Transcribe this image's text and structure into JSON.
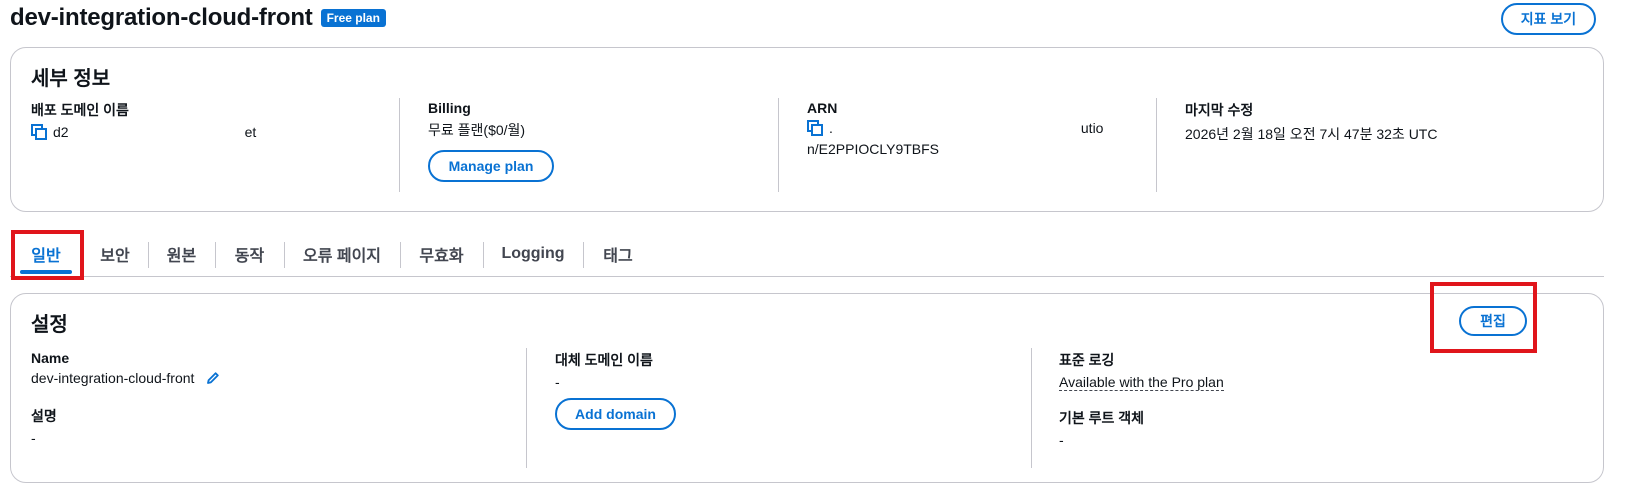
{
  "header": {
    "title": "dev-integration-cloud-front",
    "badge": "Free plan",
    "metrics_button": "지표 보기"
  },
  "details": {
    "heading": "세부 정보",
    "domain": {
      "label": "배포 도메인 이름",
      "value_start": "d2",
      "value_end": "et"
    },
    "billing": {
      "label": "Billing",
      "value": "무료 플랜($0/월)",
      "button": "Manage plan"
    },
    "arn": {
      "label": "ARN",
      "value_start": ".",
      "value_end": "utio",
      "value_line2": "n/E2PPIOCLY9TBFS"
    },
    "modified": {
      "label": "마지막 수정",
      "value": "2026년 2월 18일 오전 7시 47분 32초 UTC"
    }
  },
  "tabs": [
    {
      "label": "일반",
      "active": true
    },
    {
      "label": "보안"
    },
    {
      "label": "원본"
    },
    {
      "label": "동작"
    },
    {
      "label": "오류 페이지"
    },
    {
      "label": "무효화"
    },
    {
      "label": "Logging"
    },
    {
      "label": "태그"
    }
  ],
  "settings": {
    "heading": "설정",
    "edit_button": "편집",
    "name": {
      "label": "Name",
      "value": "dev-integration-cloud-front"
    },
    "description": {
      "label": "설명",
      "value": "-"
    },
    "alt_domain": {
      "label": "대체 도메인 이름",
      "value": "-",
      "button": "Add domain"
    },
    "std_logging": {
      "label": "표준 로깅",
      "value": "Available with the Pro plan"
    },
    "root_object": {
      "label": "기본 루트 객체",
      "value": "-"
    }
  },
  "colors": {
    "accent": "#0972d3",
    "highlight": "#e0151b",
    "border": "#c6c6cd"
  }
}
